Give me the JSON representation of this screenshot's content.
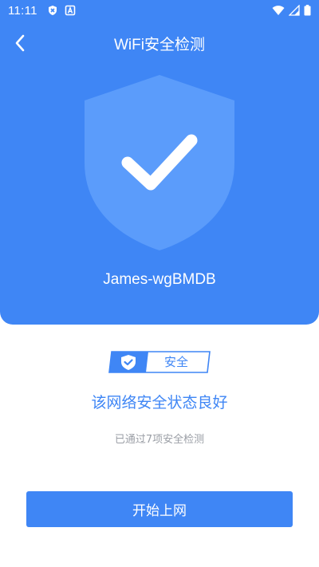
{
  "status_bar": {
    "time": "11:11",
    "left_icons": [
      "shield-x-icon",
      "a-box-icon"
    ],
    "right_icons": [
      "wifi-icon",
      "signal-icon",
      "battery-icon"
    ]
  },
  "header": {
    "title": "WiFi安全检测",
    "back_icon": "chevron-left-icon"
  },
  "network": {
    "ssid": "James-wgBMDB",
    "status_icon": "shield-check-icon"
  },
  "result": {
    "badge_label": "安全",
    "title": "该网络安全状态良好",
    "subtitle": "已通过7项安全检测"
  },
  "actions": {
    "start_label": "开始上网"
  },
  "colors": {
    "primary": "#3f86f5",
    "shield": "#5b9cfb",
    "subtitle": "#9a9ea5"
  }
}
